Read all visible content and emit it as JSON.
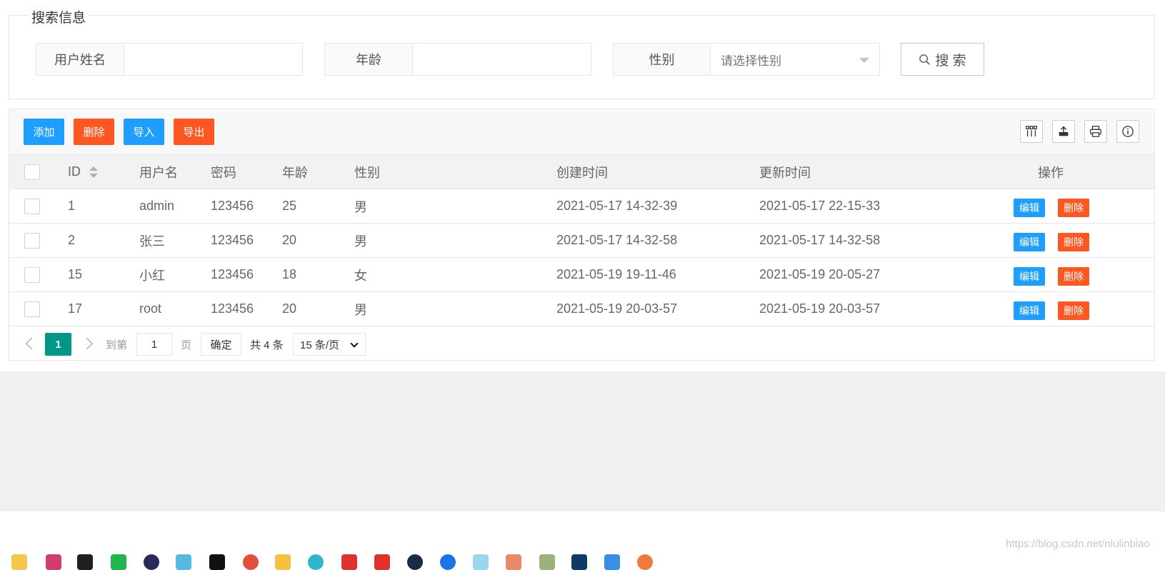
{
  "search": {
    "legend": "搜索信息",
    "fields": [
      {
        "label": "用户姓名",
        "value": ""
      },
      {
        "label": "年龄",
        "value": ""
      },
      {
        "label": "性别",
        "placeholder": "请选择性别"
      }
    ],
    "search_button": "搜 索"
  },
  "toolbar": {
    "add": "添加",
    "delete": "删除",
    "import": "导入",
    "export": "导出",
    "icons": [
      "columns-icon",
      "export-icon",
      "print-icon",
      "info-icon"
    ]
  },
  "table": {
    "columns": [
      "ID",
      "用户名",
      "密码",
      "年龄",
      "性别",
      "创建时间",
      "更新时间",
      "操作"
    ],
    "rows": [
      {
        "id": "1",
        "username": "admin",
        "password": "123456",
        "age": "25",
        "gender": "男",
        "created": "2021-05-17 14-32-39",
        "updated": "2021-05-17 22-15-33"
      },
      {
        "id": "2",
        "username": "张三",
        "password": "123456",
        "age": "20",
        "gender": "男",
        "created": "2021-05-17 14-32-58",
        "updated": "2021-05-17 14-32-58"
      },
      {
        "id": "15",
        "username": "小红",
        "password": "123456",
        "age": "18",
        "gender": "女",
        "created": "2021-05-19 19-11-46",
        "updated": "2021-05-19 20-05-27"
      },
      {
        "id": "17",
        "username": "root",
        "password": "123456",
        "age": "20",
        "gender": "男",
        "created": "2021-05-19 20-03-57",
        "updated": "2021-05-19 20-03-57"
      }
    ],
    "edit_label": "编辑",
    "delete_label": "删除"
  },
  "pagination": {
    "current_page": "1",
    "goto_label": "到第",
    "goto_value": "1",
    "page_label": "页",
    "confirm": "确定",
    "total": "共 4 条",
    "per_page": "15 条/页"
  },
  "colors": {
    "blue": "#1e9fff",
    "orange": "#ff5722",
    "teal": "#009688"
  },
  "watermark": "https://blog.csdn.net/niulinbiao"
}
